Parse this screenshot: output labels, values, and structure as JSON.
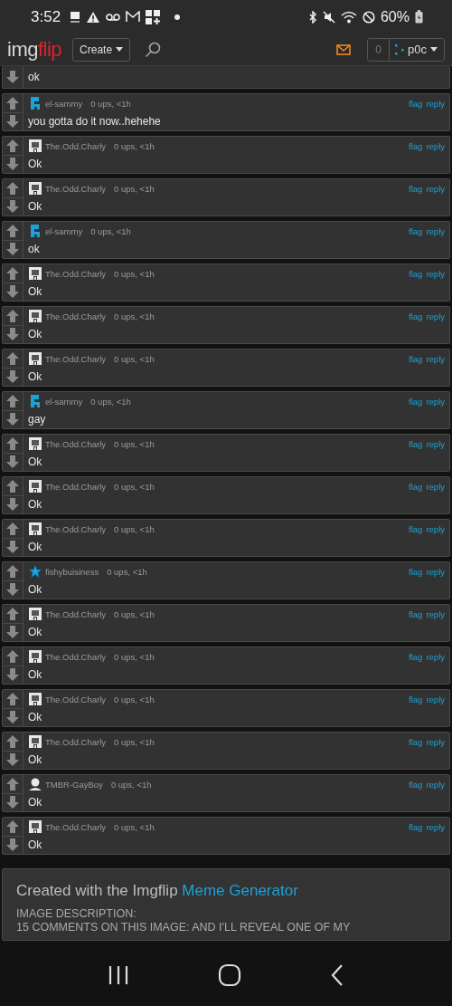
{
  "status_bar": {
    "time": "3:52",
    "battery": "60%"
  },
  "header": {
    "logo_left": "img",
    "logo_right": "flip",
    "create_button": "Create",
    "points": "0",
    "username": "p0c"
  },
  "partial_comment": {
    "text": "ok"
  },
  "comments": [
    {
      "kind": "block",
      "user": "el-sammy",
      "meta": "0 ups, <1h",
      "text": "you gotta do it now..hehehe",
      "flag": "flag",
      "reply": "reply"
    },
    {
      "kind": "pixel",
      "user": "The.Odd.Charly",
      "meta": "0 ups, <1h",
      "text": "Ok",
      "flag": "flag",
      "reply": "reply"
    },
    {
      "kind": "pixel",
      "user": "The.Odd.Charly",
      "meta": "0 ups, <1h",
      "text": "Ok",
      "flag": "flag",
      "reply": "reply"
    },
    {
      "kind": "block",
      "user": "el-sammy",
      "meta": "0 ups, <1h",
      "text": "ok",
      "flag": "flag",
      "reply": "reply"
    },
    {
      "kind": "pixel",
      "user": "The.Odd.Charly",
      "meta": "0 ups, <1h",
      "text": "Ok",
      "flag": "flag",
      "reply": "reply"
    },
    {
      "kind": "pixel",
      "user": "The.Odd.Charly",
      "meta": "0 ups, <1h",
      "text": "Ok",
      "flag": "flag",
      "reply": "reply"
    },
    {
      "kind": "pixel",
      "user": "The.Odd.Charly",
      "meta": "0 ups, <1h",
      "text": "Ok",
      "flag": "flag",
      "reply": "reply"
    },
    {
      "kind": "block",
      "user": "el-sammy",
      "meta": "0 ups, <1h",
      "text": "gay",
      "flag": "flag",
      "reply": "reply"
    },
    {
      "kind": "pixel",
      "user": "The.Odd.Charly",
      "meta": "0 ups, <1h",
      "text": "Ok",
      "flag": "flag",
      "reply": "reply"
    },
    {
      "kind": "pixel",
      "user": "The.Odd.Charly",
      "meta": "0 ups, <1h",
      "text": "Ok",
      "flag": "flag",
      "reply": "reply"
    },
    {
      "kind": "pixel",
      "user": "The.Odd.Charly",
      "meta": "0 ups, <1h",
      "text": "Ok",
      "flag": "flag",
      "reply": "reply"
    },
    {
      "kind": "star",
      "user": "fishybuisiness",
      "meta": "0 ups, <1h",
      "text": "Ok",
      "flag": "flag",
      "reply": "reply"
    },
    {
      "kind": "pixel",
      "user": "The.Odd.Charly",
      "meta": "0 ups, <1h",
      "text": "Ok",
      "flag": "flag",
      "reply": "reply"
    },
    {
      "kind": "pixel",
      "user": "The.Odd.Charly",
      "meta": "0 ups, <1h",
      "text": "Ok",
      "flag": "flag",
      "reply": "reply"
    },
    {
      "kind": "pixel",
      "user": "The.Odd.Charly",
      "meta": "0 ups, <1h",
      "text": "Ok",
      "flag": "flag",
      "reply": "reply"
    },
    {
      "kind": "pixel",
      "user": "The.Odd.Charly",
      "meta": "0 ups, <1h",
      "text": "Ok",
      "flag": "flag",
      "reply": "reply"
    },
    {
      "kind": "person",
      "user": "TMBR-GayBoy",
      "meta": "0 ups, <1h",
      "text": "Ok",
      "flag": "flag",
      "reply": "reply"
    },
    {
      "kind": "pixel",
      "user": "The.Odd.Charly",
      "meta": "0 ups, <1h",
      "text": "Ok",
      "flag": "flag",
      "reply": "reply"
    }
  ],
  "footer_card": {
    "created_text": "Created with the Imgflip",
    "generator_link": "Meme Generator",
    "description_label": "IMAGE DESCRIPTION:",
    "description_text": "15 COMMENTS ON THIS IMAGE: AND I'LL REVEAL ONE OF MY"
  }
}
